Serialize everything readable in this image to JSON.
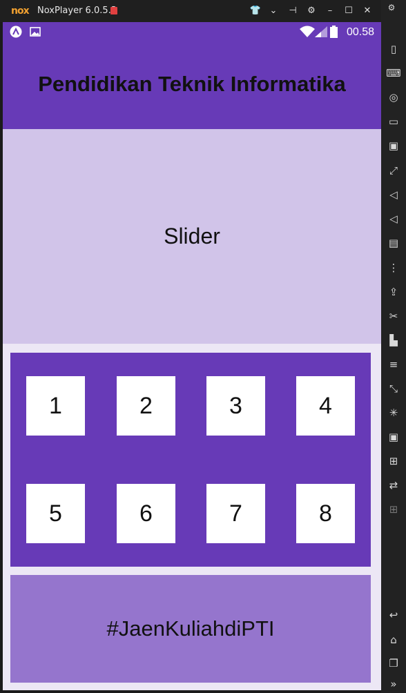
{
  "window": {
    "title": "NoxPlayer 6.0.5.3",
    "logo_text": "nox",
    "controls": [
      "shirt-icon",
      "chevron-down-icon",
      "pin-icon",
      "gear-icon",
      "minimize-icon",
      "maximize-icon",
      "close-icon"
    ]
  },
  "statusbar": {
    "time": "00.58"
  },
  "app": {
    "title": "Pendidikan Teknik Informatika",
    "slider_label": "Slider",
    "grid_items": [
      "1",
      "2",
      "3",
      "4",
      "5",
      "6",
      "7",
      "8"
    ],
    "footer_text": "#JaenKuliahdiPTI"
  },
  "colors": {
    "primary": "#673ab7",
    "slider_bg": "#d1c4e9",
    "footer_bg": "#9575cd",
    "tile_bg": "#ffffff"
  },
  "sidebar": {
    "icons": [
      "phone-icon",
      "keyboard-icon",
      "location-icon",
      "screen-icon",
      "screenshot-icon",
      "fullscreen-icon",
      "volume-up-icon",
      "volume-down-icon",
      "toolbox-icon",
      "shake-icon",
      "apk-icon",
      "scissors-icon",
      "multi-instance-icon",
      "menu-icon",
      "resize-icon",
      "loading-icon",
      "video-icon",
      "gamepad-icon",
      "sync-icon",
      "add-icon",
      "back-icon",
      "home-icon",
      "recents-icon",
      "expand-icon"
    ]
  }
}
